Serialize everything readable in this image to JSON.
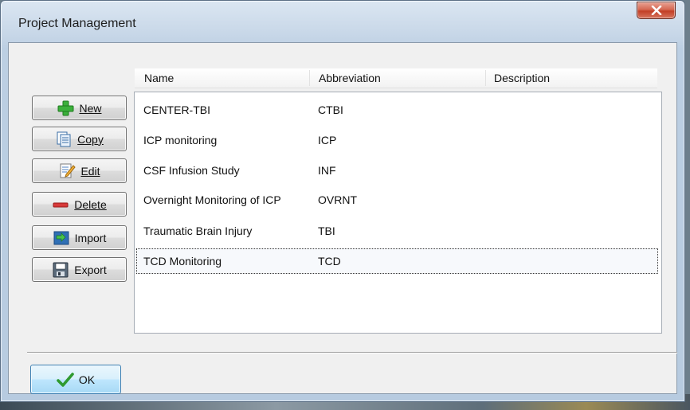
{
  "window": {
    "title": "Project Management"
  },
  "buttons": {
    "new": {
      "label": "New",
      "icon": "plus-icon"
    },
    "copy": {
      "label": "Copy",
      "icon": "copy-document-icon"
    },
    "edit": {
      "label": "Edit",
      "icon": "edit-document-icon"
    },
    "delete": {
      "label": "Delete",
      "icon": "minus-icon"
    },
    "import": {
      "label": "Import",
      "icon": "import-arrows-icon"
    },
    "export": {
      "label": "Export",
      "icon": "save-disk-icon"
    },
    "ok": {
      "label": "OK",
      "icon": "checkmark-icon"
    }
  },
  "list": {
    "columns": [
      "Name",
      "Abbreviation",
      "Description"
    ],
    "rows": [
      {
        "name": "CENTER-TBI",
        "abbreviation": "CTBI",
        "description": ""
      },
      {
        "name": "ICP monitoring",
        "abbreviation": "ICP",
        "description": ""
      },
      {
        "name": "CSF Infusion Study",
        "abbreviation": "INF",
        "description": ""
      },
      {
        "name": "Overnight Monitoring of ICP",
        "abbreviation": "OVRNT",
        "description": ""
      },
      {
        "name": "Traumatic Brain Injury",
        "abbreviation": "TBI",
        "description": ""
      },
      {
        "name": "TCD Monitoring",
        "abbreviation": "TCD",
        "description": ""
      }
    ],
    "selected_row": "TCD Monitoring"
  },
  "colors": {
    "accent": "#3c7fb1",
    "close": "#c23f26",
    "add": "#2fa82f",
    "delete": "#d42a2a"
  }
}
